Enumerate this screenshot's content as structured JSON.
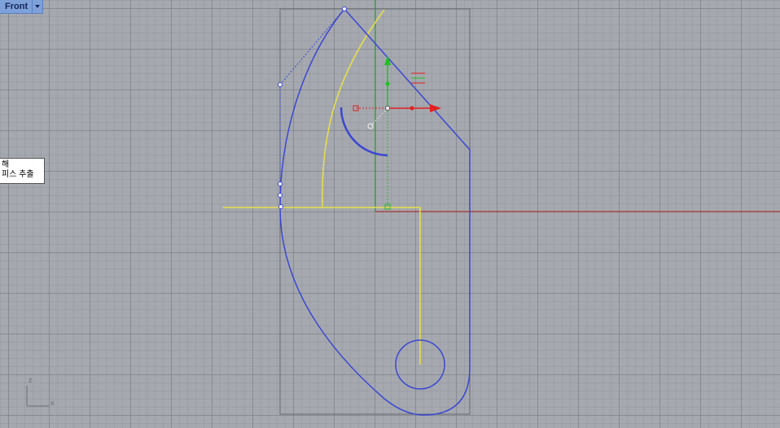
{
  "viewport": {
    "title": "Front",
    "dropdown_icon": "chevron-down-icon"
  },
  "tooltip": {
    "line1": "해",
    "line2": "피스 추출"
  },
  "axis_indicator": {
    "z_label": "z",
    "x_label": "x"
  },
  "colors": {
    "background": "#a5a9af",
    "curve": "#3c46d2",
    "yellow": "#e8e04a",
    "x_axis": "#b22222",
    "y_axis": "#1f9a1f",
    "gumball_x": "#e02020",
    "gumball_y": "#20c020"
  }
}
